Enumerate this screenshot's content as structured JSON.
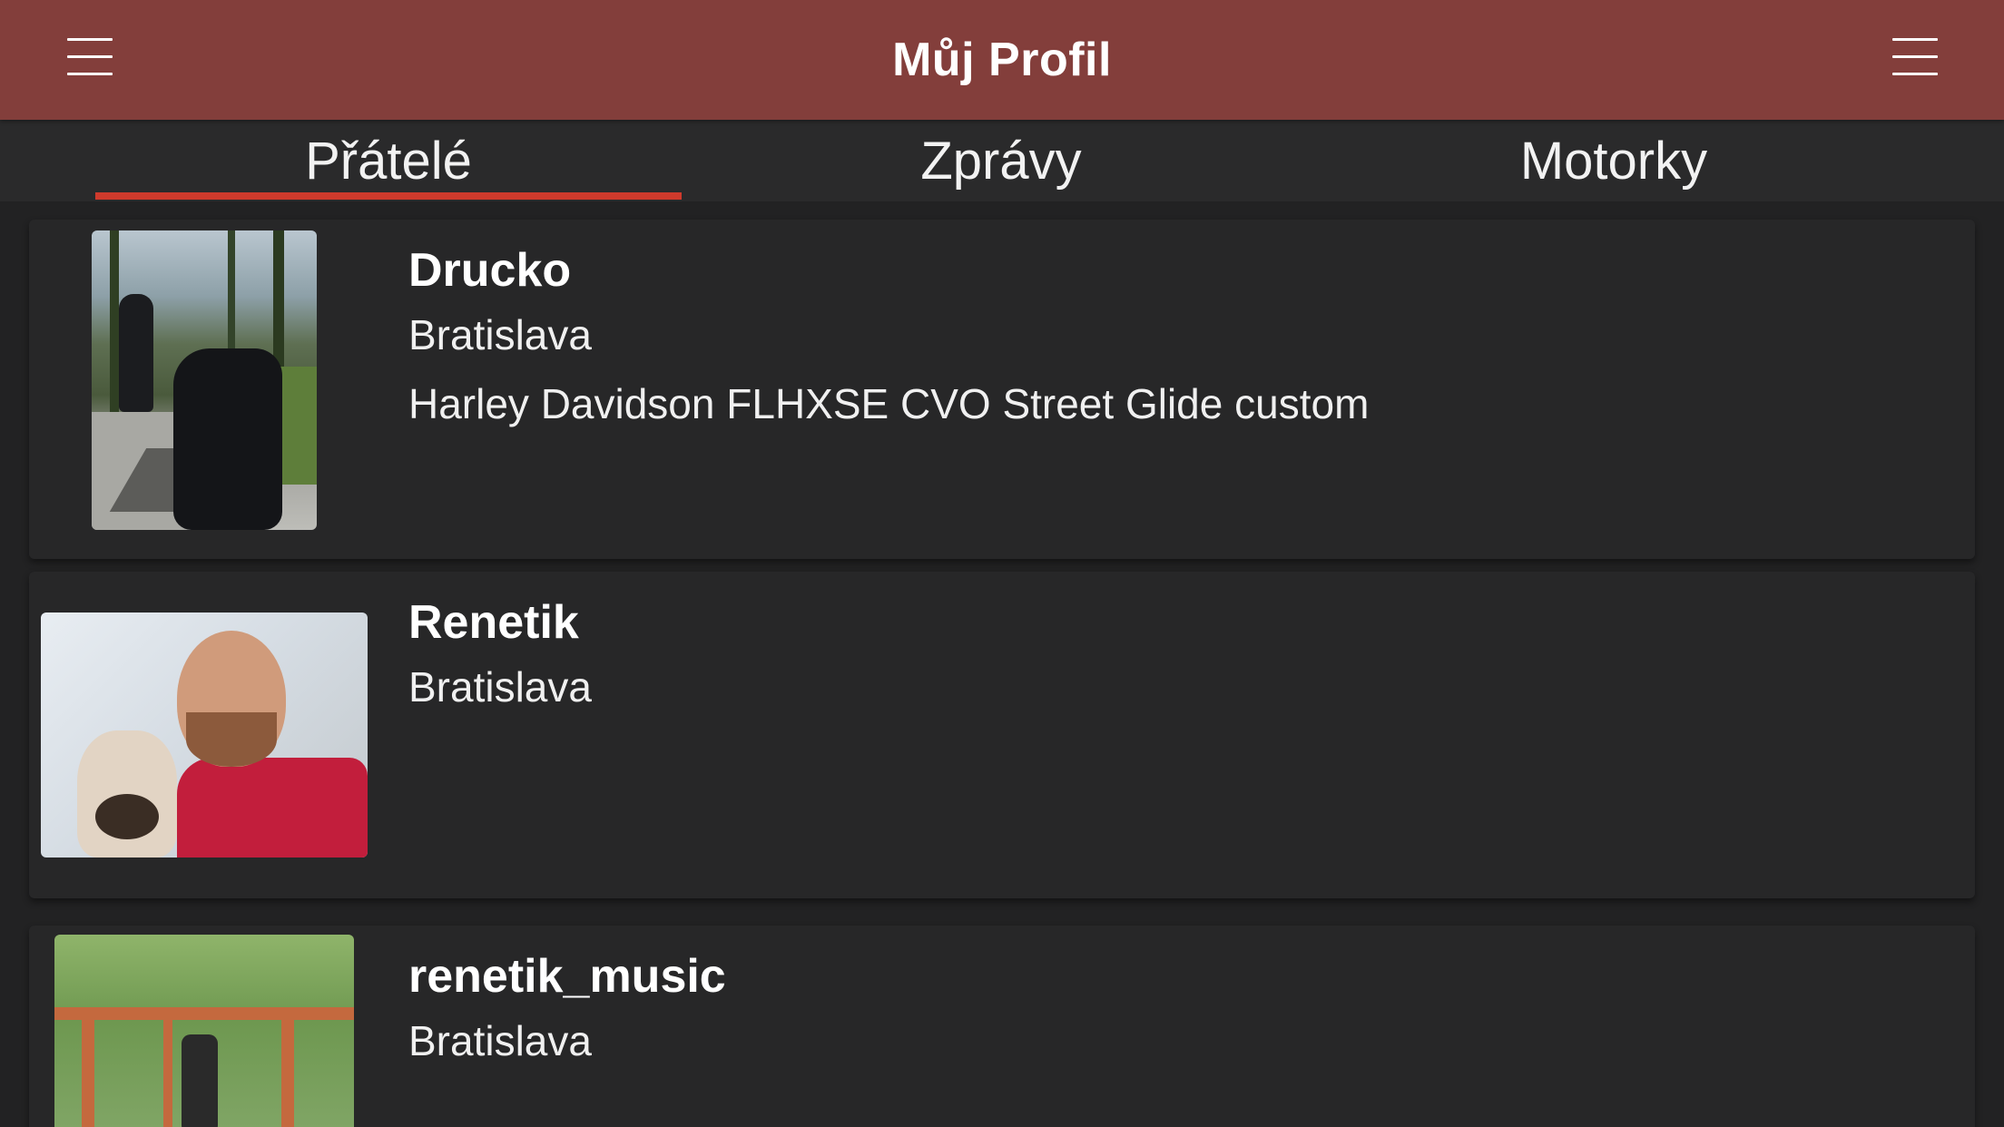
{
  "header": {
    "title": "Můj Profil",
    "left_menu_icon": "hamburger-menu-icon",
    "right_menu_icon": "hamburger-menu-icon"
  },
  "tabs": [
    {
      "label": "Přátelé",
      "active": true
    },
    {
      "label": "Zprávy",
      "active": false
    },
    {
      "label": "Motorky",
      "active": false
    }
  ],
  "colors": {
    "header_bg": "#833e3b",
    "tab_indicator": "#cf3a2c",
    "background": "#222223"
  },
  "friends": [
    {
      "name": "Drucko",
      "city": "Bratislava",
      "bike": "Harley Davidson FLHXSE CVO Street Glide custom"
    },
    {
      "name": "Renetik",
      "city": "Bratislava"
    },
    {
      "name": "renetik_music",
      "city": "Bratislava"
    }
  ]
}
